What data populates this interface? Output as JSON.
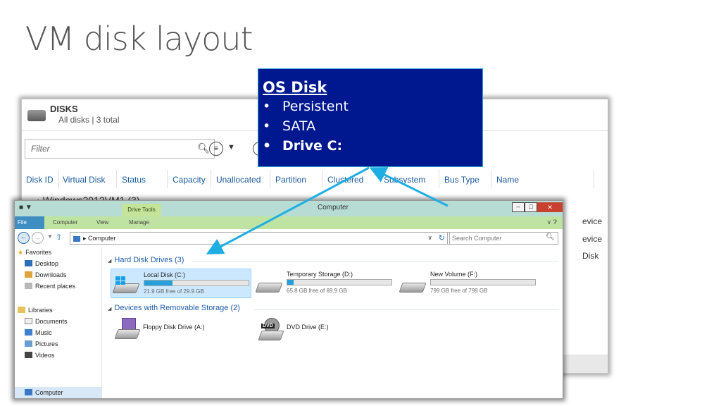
{
  "slide": {
    "title": "VM disk layout"
  },
  "callout": {
    "title": "OS Disk",
    "items": [
      "Persistent",
      "SATA",
      "Drive C:"
    ]
  },
  "disks_panel": {
    "heading": "DISKS",
    "subheading": "All disks | 3 total",
    "filter_placeholder": "Filter",
    "columns": [
      "Disk ID",
      "Virtual Disk",
      "Status",
      "Capacity",
      "Unallocated",
      "Partition",
      "Clustered",
      "Subsystem",
      "Bus Type",
      "Name"
    ],
    "group": "Windows2012VM1 (3)",
    "right_cells": [
      "evice",
      "evice",
      "Disk"
    ]
  },
  "explorer": {
    "title": "Computer",
    "context_tab": "Drive Tools",
    "ribbon_tabs": [
      "File",
      "Computer",
      "View",
      "Manage"
    ],
    "address": "Computer",
    "search_placeholder": "Search Computer",
    "nav": {
      "favorites": "Favorites",
      "desktop": "Desktop",
      "downloads": "Downloads",
      "recent": "Recent places",
      "libraries": "Libraries",
      "documents": "Documents",
      "music": "Music",
      "pictures": "Pictures",
      "videos": "Videos",
      "computer": "Computer"
    },
    "hdd_group": "Hard Disk Drives (3)",
    "removable_group": "Devices with Removable Storage (2)",
    "drives": [
      {
        "name": "Local Disk (C:)",
        "free": "21.9 GB free of 29.9 GB",
        "used_fraction": 0.27
      },
      {
        "name": "Temporary Storage (D:)",
        "free": "65.8 GB free of 69.9 GB",
        "used_fraction": 0.06
      },
      {
        "name": "New Volume (F:)",
        "free": "799 GB free of 799 GB",
        "used_fraction": 0.0
      }
    ],
    "devices": [
      {
        "name": "Floppy Disk Drive (A:)",
        "icon": "floppy-icon"
      },
      {
        "name": "DVD Drive (E:)",
        "icon": "dvd-icon",
        "badge": "DVD"
      }
    ]
  },
  "colors": {
    "callout_bg": "#00188f",
    "arrow": "#1eaee4",
    "ribbon": "#bfe3a2",
    "accent_blue": "#1e5ba8"
  }
}
